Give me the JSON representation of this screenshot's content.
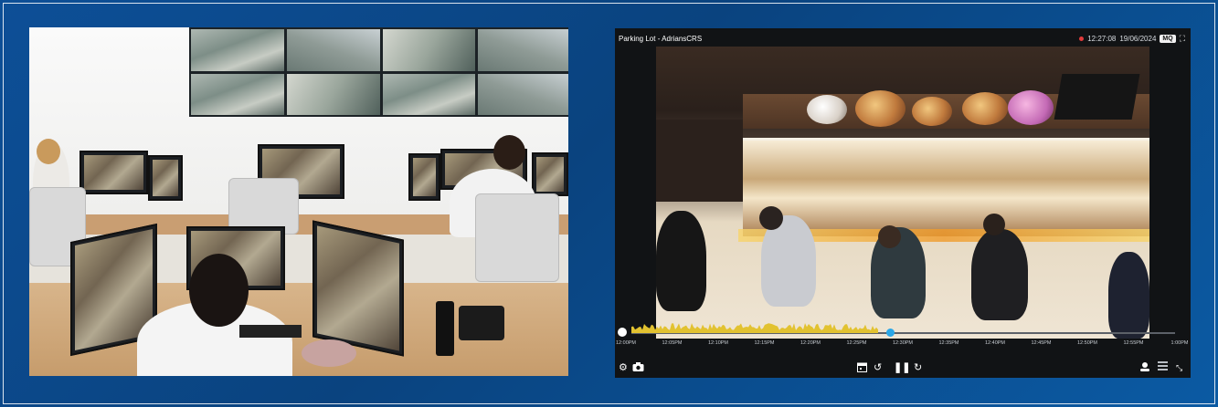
{
  "player": {
    "camera_name": "Parking Lot",
    "separator": "-",
    "site_name": "AdriansCRS",
    "time": "12:27:08",
    "date": "19/06/2024",
    "quality_badge": "MQ",
    "timeline_ticks": [
      "12:00PM",
      "12:05PM",
      "12:10PM",
      "12:15PM",
      "12:20PM",
      "12:25PM",
      "12:30PM",
      "12:35PM",
      "12:40PM",
      "12:45PM",
      "12:50PM",
      "12:55PM",
      "1:00PM"
    ],
    "playhead_fraction": 0.475,
    "icons": {
      "timeline_play": "play-circle-icon",
      "settings": "gear-icon",
      "snapshot": "camera-icon",
      "calendar": "calendar-icon",
      "rewind": "rewind-icon",
      "pause": "pause-icon",
      "forward": "forward-icon",
      "user": "user-icon",
      "layout": "layout-icon",
      "fullscreen": "fullscreen-icon"
    },
    "colors": {
      "activity": "#e2c230",
      "playhead": "#2aa7e7",
      "recording": "#e23b3b"
    }
  },
  "background": {
    "accent": "#0d4f97"
  }
}
